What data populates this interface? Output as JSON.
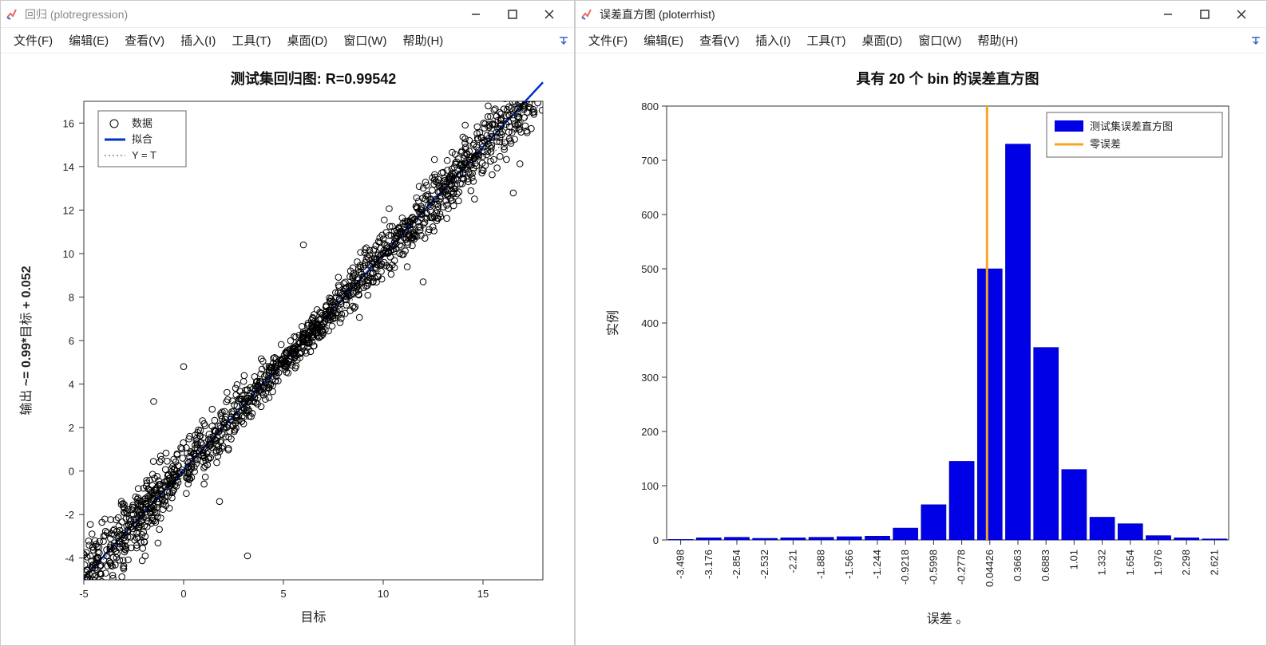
{
  "windows": {
    "left": {
      "title": "回归 (plotregression)",
      "menus": [
        "文件(F)",
        "编辑(E)",
        "查看(V)",
        "插入(I)",
        "工具(T)",
        "桌面(D)",
        "窗口(W)",
        "帮助(H)"
      ]
    },
    "right": {
      "title": "误差直方图 (ploterrhist)",
      "menus": [
        "文件(F)",
        "编辑(E)",
        "查看(V)",
        "插入(I)",
        "工具(T)",
        "桌面(D)",
        "窗口(W)",
        "帮助(H)"
      ]
    }
  },
  "chart_data": [
    {
      "id": "regression",
      "type": "scatter",
      "title": "测试集回归图: R=0.99542",
      "xlabel": "目标",
      "ylabel": "输出 ~= 0.99*目标 + 0.052",
      "xlim": [
        -5,
        18
      ],
      "ylim": [
        -5,
        17
      ],
      "xticks": [
        -5,
        0,
        5,
        10,
        15
      ],
      "yticks": [
        -4,
        -2,
        0,
        2,
        4,
        6,
        8,
        10,
        12,
        14,
        16
      ],
      "fit": {
        "slope": 0.99,
        "intercept": 0.052
      },
      "identity": {
        "slope": 1,
        "intercept": 0
      },
      "legend": {
        "data": "数据",
        "fit": "拟合",
        "identity": "Y = T"
      },
      "r": 0.99542,
      "points_estimated": true
    },
    {
      "id": "errhist",
      "type": "bar",
      "title_prefix": "具有 ",
      "title_bins": "20",
      "title_mid": " 个 bin ",
      "title_suffix": "的误差直方图",
      "xlabel": "误差 。",
      "ylabel": "实例",
      "ylim": [
        0,
        800
      ],
      "yticks": [
        0,
        100,
        200,
        300,
        400,
        500,
        600,
        700,
        800
      ],
      "categories": [
        "-3.498",
        "-3.176",
        "-2.854",
        "-2.532",
        "-2.21",
        "-1.888",
        "-1.566",
        "-1.244",
        "-0.9218",
        "-0.5998",
        "-0.2778",
        "0.04426",
        "0.3663",
        "0.6883",
        "1.01",
        "1.332",
        "1.654",
        "1.976",
        "2.298",
        "2.621"
      ],
      "values": [
        1,
        4,
        5,
        3,
        4,
        5,
        6,
        7,
        22,
        65,
        145,
        500,
        730,
        355,
        130,
        42,
        30,
        8,
        4,
        2
      ],
      "zero_error_at": "0.04426",
      "legend": {
        "bars": "测试集误差直方图",
        "zero": "零误差"
      },
      "colors": {
        "bar": "#0000e6",
        "zero": "#f5a623"
      }
    }
  ]
}
